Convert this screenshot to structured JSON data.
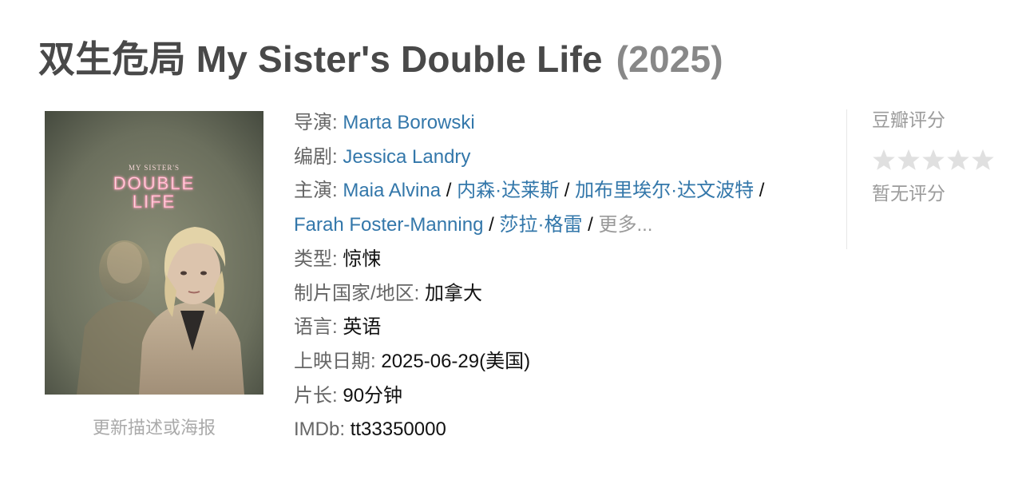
{
  "title": {
    "main": "双生危局 My Sister's Double Life",
    "year": "(2025)"
  },
  "poster": {
    "text_line1": "MY SISTER'S",
    "text_line2": "DOUBLE",
    "text_line3": "LIFE",
    "update_link": "更新描述或海报"
  },
  "info": {
    "director_label": "导演",
    "directors": [
      "Marta Borowski"
    ],
    "writer_label": "编剧",
    "writers": [
      "Jessica Landry"
    ],
    "cast_label": "主演",
    "cast": [
      "Maia Alvina",
      "内森·达莱斯",
      "加布里埃尔·达文波特",
      "Farah Foster-Manning",
      "莎拉·格雷"
    ],
    "cast_separator": " / ",
    "more": "更多...",
    "genre_label": "类型",
    "genre": "惊悚",
    "country_label": "制片国家/地区",
    "country": "加拿大",
    "language_label": "语言",
    "language": "英语",
    "release_label": "上映日期",
    "release": "2025-06-29(美国)",
    "runtime_label": "片长",
    "runtime": "90分钟",
    "imdb_label": "IMDb",
    "imdb": "tt33350000",
    "colon": ": "
  },
  "rating": {
    "label": "豆瓣评分",
    "stars_filled": 0,
    "stars_total": 5,
    "star_color": "#e0e0e0",
    "no_rating": "暂无评分"
  },
  "colors": {
    "link": "#3377aa",
    "title": "#494949",
    "year": "#888888",
    "label": "#666666"
  }
}
